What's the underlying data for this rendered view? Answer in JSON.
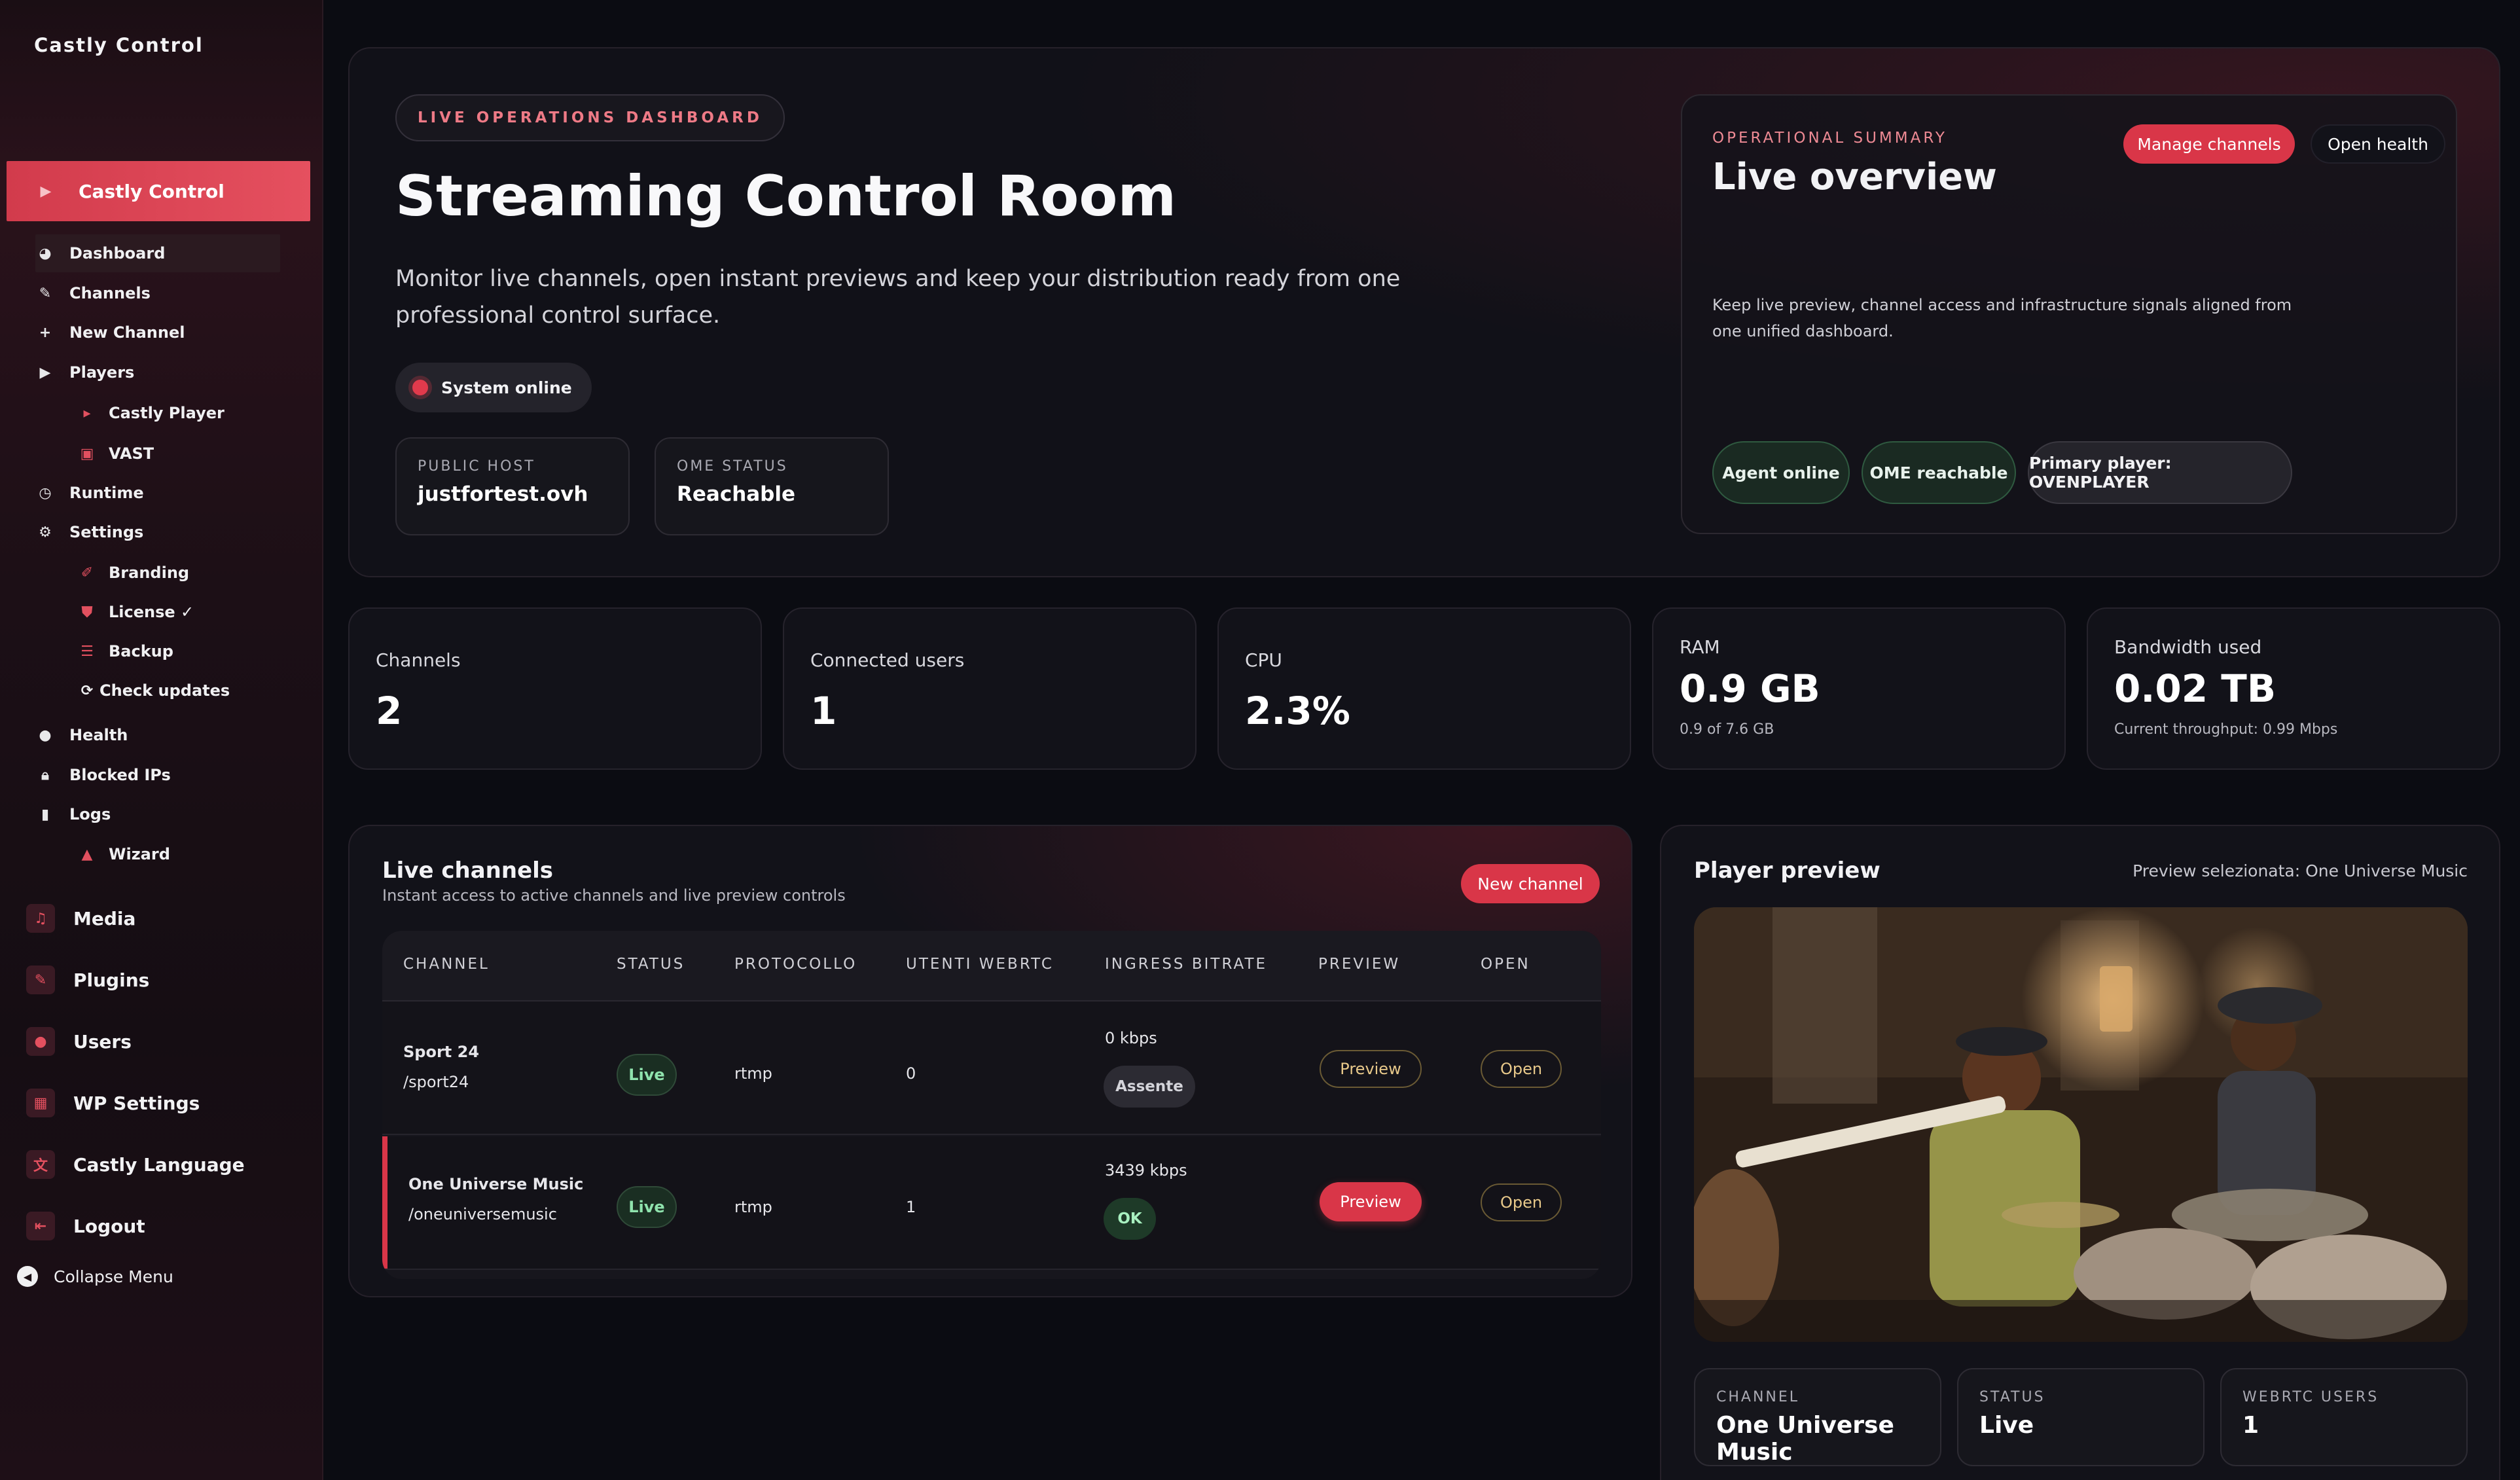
{
  "sidebar": {
    "brand": "Castly Control",
    "main_item": {
      "label": "Castly Control",
      "icon": "play-icon"
    },
    "items": [
      {
        "label": "Dashboard",
        "icon": "dashboard-icon"
      },
      {
        "label": "Channels",
        "icon": "pin-icon"
      },
      {
        "label": "New Channel",
        "icon": "plus-icon"
      },
      {
        "label": "Players",
        "icon": "play-icon"
      },
      {
        "label": "Castly Player",
        "icon": "play-icon"
      },
      {
        "label": "VAST",
        "icon": "ad-icon"
      },
      {
        "label": "Runtime",
        "icon": "clock-icon"
      },
      {
        "label": "Settings",
        "icon": "gear-icon"
      },
      {
        "label": "Branding",
        "icon": "brush-icon"
      },
      {
        "label": "License ✓",
        "icon": "shield-icon"
      },
      {
        "label": "Backup",
        "icon": "database-icon"
      },
      {
        "label": "Check updates",
        "icon": "refresh-icon"
      },
      {
        "label": "Health",
        "icon": "alert-icon"
      },
      {
        "label": "Blocked IPs",
        "icon": "lock-icon"
      },
      {
        "label": "Logs",
        "icon": "trash-icon"
      },
      {
        "label": "Wizard",
        "icon": "graduation-icon"
      }
    ],
    "menu": [
      {
        "label": "Media",
        "icon": "media-icon"
      },
      {
        "label": "Plugins",
        "icon": "plug-icon"
      },
      {
        "label": "Users",
        "icon": "user-icon"
      },
      {
        "label": "WP Settings",
        "icon": "grid-icon"
      },
      {
        "label": "Castly Language",
        "icon": "language-icon"
      },
      {
        "label": "Logout",
        "icon": "logout-icon"
      }
    ],
    "collapse_label": "Collapse Menu"
  },
  "hero": {
    "tag": "LIVE OPERATIONS DASHBOARD",
    "title": "Streaming Control Room",
    "description": "Monitor live channels, open instant previews and keep your distribution ready from one professional control surface.",
    "system_status": "System online",
    "public_host_label": "PUBLIC HOST",
    "public_host_value": "justfortest.ovh",
    "ome_status_label": "OME STATUS",
    "ome_status_value": "Reachable"
  },
  "summary": {
    "label": "OPERATIONAL SUMMARY",
    "title": "Live overview",
    "manage_button": "Manage channels",
    "health_button": "Open health",
    "text": "Keep live preview, channel access and infrastructure signals aligned from one unified dashboard.",
    "chips": [
      "Agent online",
      "OME reachable",
      "Primary player: OVENPLAYER"
    ]
  },
  "stats": [
    {
      "label": "Channels",
      "value": "2",
      "sub": ""
    },
    {
      "label": "Connected users",
      "value": "1",
      "sub": ""
    },
    {
      "label": "CPU",
      "value": "2.3%",
      "sub": ""
    },
    {
      "label": "RAM",
      "value": "0.9 GB",
      "sub": "0.9 of 7.6 GB"
    },
    {
      "label": "Bandwidth used",
      "value": "0.02 TB",
      "sub": "Current throughput: 0.99 Mbps"
    }
  ],
  "live_channels": {
    "title": "Live channels",
    "description": "Instant access to active channels and live preview controls",
    "new_button": "New channel",
    "columns": [
      "CHANNEL",
      "STATUS",
      "PROTOCOLLO",
      "UTENTI WEBRTC",
      "INGRESS BITRATE",
      "PREVIEW",
      "OPEN"
    ],
    "rows": [
      {
        "name": "Sport 24",
        "path": "/sport24",
        "status": "Live",
        "protocol": "rtmp",
        "users": "0",
        "bitrate": "0 kbps",
        "state": "Assente",
        "preview": "Preview",
        "open": "Open"
      },
      {
        "name": "One Universe Music",
        "path": "/oneuniversemusic",
        "status": "Live",
        "protocol": "rtmp",
        "users": "1",
        "bitrate": "3439 kbps",
        "state": "OK",
        "preview": "Preview",
        "open": "Open"
      }
    ]
  },
  "player": {
    "title": "Player preview",
    "selected": "Preview selezionata: One Universe Music",
    "channel_label": "CHANNEL",
    "channel_value": "One Universe Music",
    "status_label": "STATUS",
    "status_value": "Live",
    "users_label": "WEBRTC USERS",
    "users_value": "1"
  },
  "colors": {
    "accent": "#d93648",
    "background": "#0b0c12",
    "card": "#121219",
    "success": "#8fe3ad"
  }
}
